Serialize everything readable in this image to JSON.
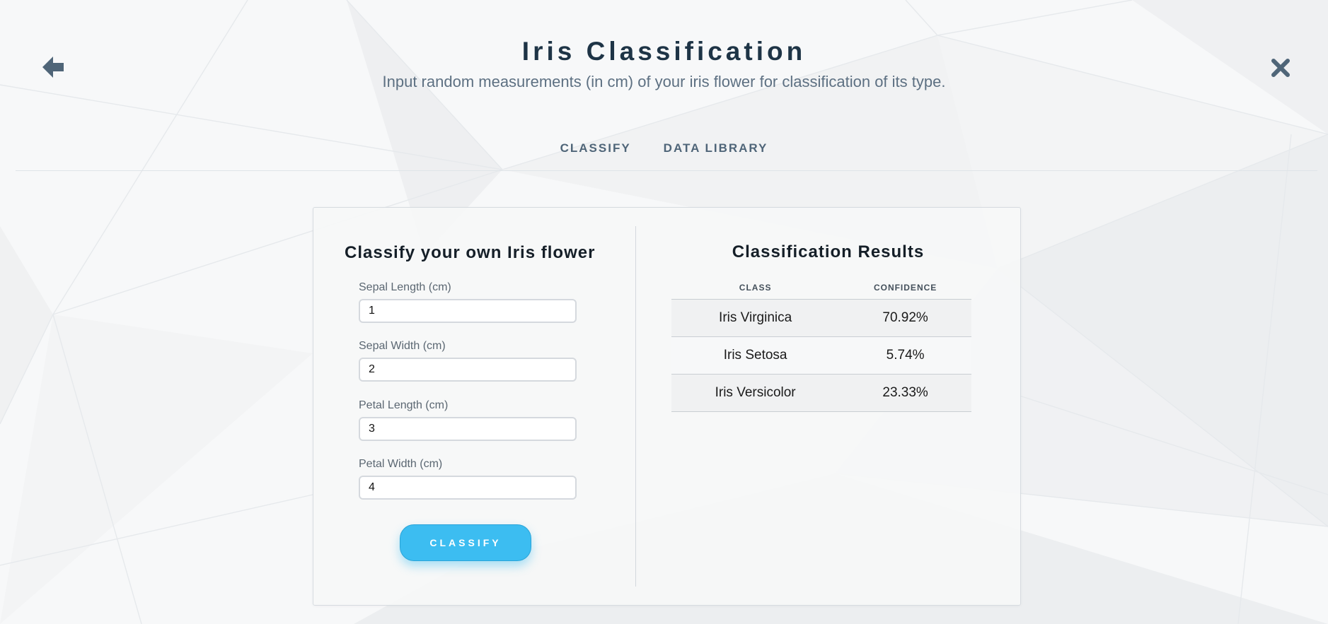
{
  "header": {
    "title": "Iris Classification",
    "subtitle": "Input random measurements (in cm) of your iris flower for classification of its type.",
    "back_icon": "arrow-left-icon",
    "close_icon": "close-x-icon"
  },
  "tabs": [
    {
      "label": "CLASSIFY"
    },
    {
      "label": "DATA LIBRARY"
    }
  ],
  "form": {
    "title": "Classify your own Iris flower",
    "fields": [
      {
        "label": "Sepal Length (cm)",
        "value": "1"
      },
      {
        "label": "Sepal Width (cm)",
        "value": "2"
      },
      {
        "label": "Petal Length (cm)",
        "value": "3"
      },
      {
        "label": "Petal Width (cm)",
        "value": "4"
      }
    ],
    "button_label": "CLASSIFY"
  },
  "results": {
    "title": "Classification Results",
    "columns": [
      "CLASS",
      "CONFIDENCE"
    ],
    "rows": [
      {
        "class": "Iris Virginica",
        "confidence": "70.92%"
      },
      {
        "class": "Iris Setosa",
        "confidence": "5.74%"
      },
      {
        "class": "Iris Versicolor",
        "confidence": "23.33%"
      }
    ]
  },
  "colors": {
    "accent": "#3cbdf1",
    "title": "#1e3446",
    "muted_text": "#5d7082"
  }
}
